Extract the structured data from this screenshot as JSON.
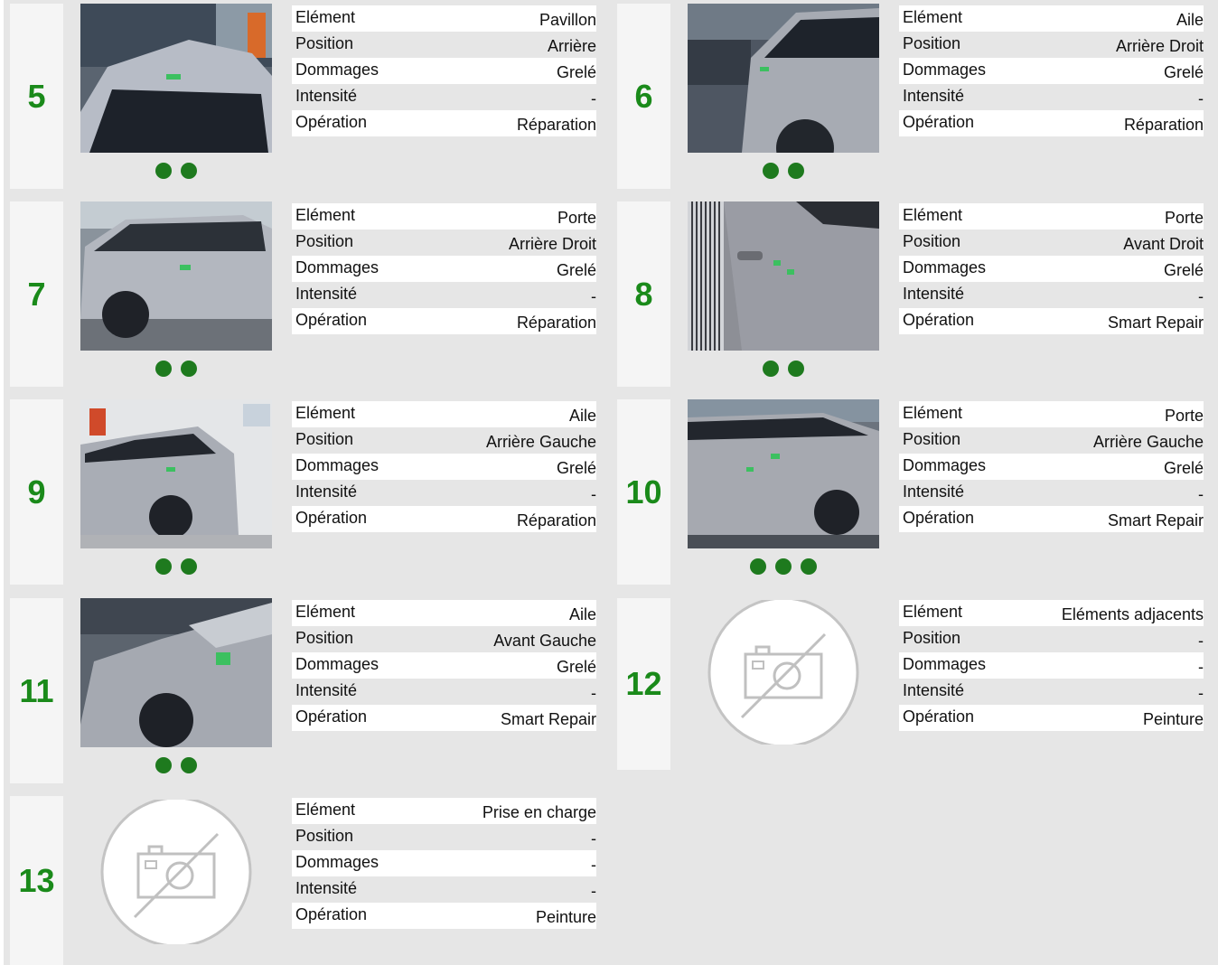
{
  "labels": {
    "element": "Elément",
    "position": "Position",
    "dommages": "Dommages",
    "intensite": "Intensité",
    "operation": "Opération"
  },
  "cards": [
    {
      "number": "5",
      "photo": "car-roof-rear-photo",
      "dots": 2,
      "element": "Pavillon",
      "position": "Arrière",
      "dommages": "Grelé",
      "intensite": "-",
      "operation": "Réparation"
    },
    {
      "number": "6",
      "photo": "car-rear-right-wing-photo",
      "dots": 2,
      "element": "Aile",
      "position": "Arrière Droit",
      "dommages": "Grelé",
      "intensite": "-",
      "operation": "Réparation"
    },
    {
      "number": "7",
      "photo": "car-right-side-photo",
      "dots": 2,
      "element": "Porte",
      "position": "Arrière Droit",
      "dommages": "Grelé",
      "intensite": "-",
      "operation": "Réparation"
    },
    {
      "number": "8",
      "photo": "car-front-right-door-photo",
      "dots": 2,
      "element": "Porte",
      "position": "Avant Droit",
      "dommages": "Grelé",
      "intensite": "-",
      "operation": "Smart Repair"
    },
    {
      "number": "9",
      "photo": "car-rear-left-wing-photo",
      "dots": 2,
      "element": "Aile",
      "position": "Arrière Gauche",
      "dommages": "Grelé",
      "intensite": "-",
      "operation": "Réparation"
    },
    {
      "number": "10",
      "photo": "car-rear-left-door-photo",
      "dots": 3,
      "element": "Porte",
      "position": "Arrière Gauche",
      "dommages": "Grelé",
      "intensite": "-",
      "operation": "Smart Repair"
    },
    {
      "number": "11",
      "photo": "car-front-left-wing-photo",
      "dots": 2,
      "element": "Aile",
      "position": "Avant Gauche",
      "dommages": "Grelé",
      "intensite": "-",
      "operation": "Smart Repair"
    },
    {
      "number": "12",
      "photo": "no-photo-icon",
      "dots": 0,
      "element": "Eléments adjacents",
      "position": "-",
      "dommages": "-",
      "intensite": "-",
      "operation": "Peinture"
    },
    {
      "number": "13",
      "photo": "no-photo-icon",
      "dots": 0,
      "element": "Prise en charge",
      "position": "-",
      "dommages": "-",
      "intensite": "-",
      "operation": "Peinture"
    }
  ],
  "colors": {
    "background": "#e6e6e6",
    "number_green": "#1a8a1a",
    "dot_green": "#1e7a1e",
    "row_alt": "#ffffff",
    "number_panel": "#f5f5f5"
  }
}
